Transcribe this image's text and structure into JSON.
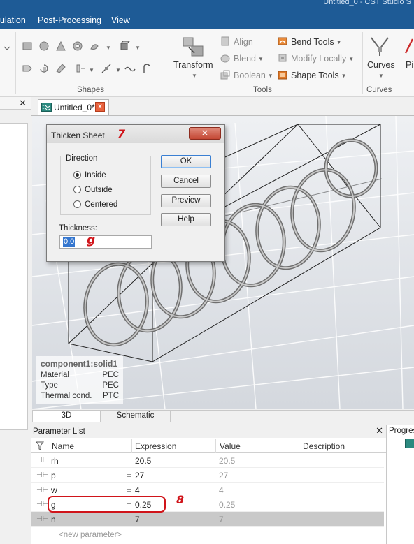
{
  "window": {
    "title": "Untitled_0 - CST Studio S"
  },
  "menu": {
    "items": [
      "ulation",
      "Post-Processing",
      "View"
    ]
  },
  "ribbon": {
    "groups": [
      {
        "label": "Shapes"
      },
      {
        "label": "Tools"
      },
      {
        "label": "Curves"
      }
    ],
    "transform_label": "Transform",
    "align_label": "Align",
    "blend_label": "Blend",
    "boolean_label": "Boolean",
    "bend_tools_label": "Bend Tools",
    "modify_locally_label": "Modify Locally",
    "shape_tools_label": "Shape Tools",
    "curves_label": "Curves",
    "pick_label": "Pi"
  },
  "document_tab": {
    "label": "Untitled_0*"
  },
  "dialog": {
    "title": "Thicken Sheet",
    "direction_label": "Direction",
    "options": [
      "Inside",
      "Outside",
      "Centered"
    ],
    "selected_option": "Inside",
    "ok_label": "OK",
    "cancel_label": "Cancel",
    "preview_label": "Preview",
    "help_label": "Help",
    "thickness_label": "Thickness:",
    "thickness_value": "0.0"
  },
  "annotations": {
    "step7": "7",
    "step8": "8",
    "g_marker": "g"
  },
  "component_info": {
    "title": "component1:solid1",
    "rows": [
      {
        "key": "Material",
        "value": "PEC"
      },
      {
        "key": "Type",
        "value": "PEC"
      },
      {
        "key": "Thermal cond.",
        "value": "PTC"
      }
    ]
  },
  "view_tabs": [
    "3D",
    "Schematic"
  ],
  "parameter_list": {
    "title": "Parameter List",
    "columns": [
      "Name",
      "Expression",
      "Value",
      "Description"
    ],
    "rows": [
      {
        "name": "rh",
        "expression": "20.5",
        "value": "20.5"
      },
      {
        "name": "p",
        "expression": "27",
        "value": "27"
      },
      {
        "name": "w",
        "expression": "4",
        "value": "4"
      },
      {
        "name": "g",
        "expression": "0.25",
        "value": "0.25"
      },
      {
        "name": "n",
        "expression": "7",
        "value": "7"
      }
    ],
    "new_parameter_placeholder": "<new parameter>"
  },
  "progress_panel": {
    "title": "Progres"
  },
  "colors": {
    "menu_blue": "#1e5b96",
    "annotation_red": "#d0141a",
    "dialog_close": "#c44734"
  }
}
